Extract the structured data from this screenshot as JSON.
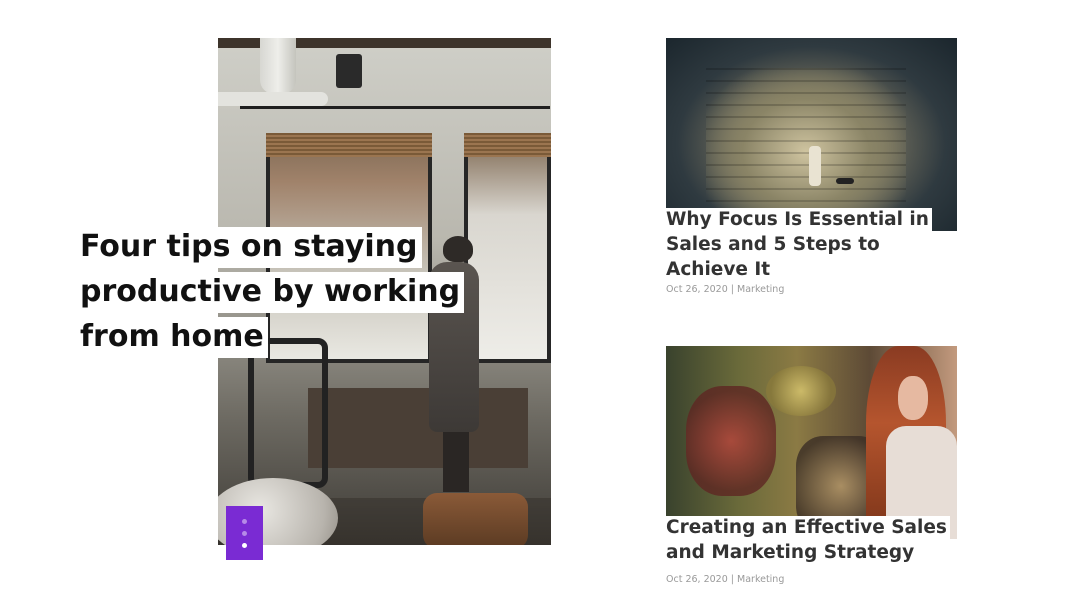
{
  "featured": {
    "title": "Four tips on staying productive by working from home",
    "slider": {
      "total": 3,
      "active_index": 2
    }
  },
  "posts": [
    {
      "title": "Why Focus Is Essential in Sales and 5 Steps to Achieve It",
      "date": "Oct 26, 2020",
      "separator": "|",
      "category": "Marketing"
    },
    {
      "title": "Creating an Effective Sales and Marketing Strategy",
      "date": "Oct 26, 2020",
      "separator": "|",
      "category": "Marketing"
    }
  ],
  "colors": {
    "accent": "#7a2bd3",
    "title": "#111111",
    "post_title": "#333333",
    "meta": "#999999",
    "background": "#ffffff"
  }
}
